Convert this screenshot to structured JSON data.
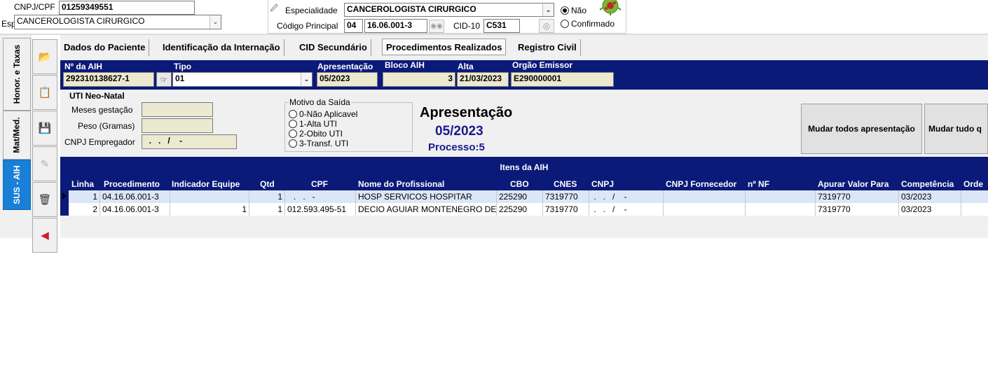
{
  "header": {
    "cnpj_label": "CNPJ/CPF",
    "cnpj_value": "01259349551",
    "esp_label_cut": "Esp",
    "esp_left_value": "CANCEROLOGISTA CIRURGICO",
    "especialidade_label": "Especialidade",
    "especialidade_value": "CANCEROLOGISTA CIRURGICO",
    "codigo_label": "Código Principal",
    "codigo_prefix": "04",
    "codigo_value": "16.06.001-3",
    "cid_label": "CID-10",
    "cid_value": "C531",
    "radio_nao": "Não",
    "radio_confirmado": "Confirmado"
  },
  "side_tabs": {
    "honor": "Honor. e Taxas",
    "mat": "Mat/Med.",
    "sus": "SUS - AIH"
  },
  "tabs": [
    "Dados do Paciente",
    "Identificação da Internação",
    "CID Secundário",
    "Procedimentos Realizados",
    "Registro Civil"
  ],
  "aih": {
    "num_label": "Nº da AIH",
    "num_value": "292310138627-1",
    "tipo_label": "Tipo",
    "tipo_value": "01",
    "apres_label": "Apresentação",
    "apres_value": "05/2023",
    "bloco_label": "Bloco AIH",
    "bloco_value": "3",
    "alta_label": "Alta",
    "alta_value": "21/03/2023",
    "orgao_label": "Orgão Emissor",
    "orgao_value": "E290000001"
  },
  "uti": {
    "title": "UTI Neo-Natal",
    "meses_label": "Meses gestação",
    "peso_label": "Peso (Gramas)",
    "cnpj_label": "CNPJ Empregador",
    "cnpj_mask": "  .   .   /    -"
  },
  "motivo": {
    "title": "Motivo da Saída",
    "options": [
      "0-Não Aplicavel",
      "1-Alta UTI",
      "2-Obito UTI",
      "3-Transf. UTI"
    ]
  },
  "apresentacao": {
    "title": "Apresentação",
    "date": "05/2023",
    "processo": "Processo:5"
  },
  "buttons": {
    "mudar_todos": "Mudar todos apresentação",
    "mudar_tudo": "Mudar tudo q"
  },
  "grid": {
    "title": "Itens da AIH",
    "columns": [
      "Linha",
      "Procedimento",
      "Indicador Equipe",
      "Qtd",
      "CPF",
      "Nome do Profissional",
      "CBO",
      "CNES",
      "CNPJ",
      "CNPJ Fornecedor",
      "nº NF",
      "Apurar Valor Para",
      "Competência",
      "Orde"
    ],
    "rows": [
      [
        "1",
        "04.16.06.001-3",
        "",
        "1",
        ".   .   -",
        "HOSP SERVICOS HOSPITAR",
        "225290",
        "7319770",
        " .   .   /    -",
        "",
        "",
        "7319770",
        "03/2023",
        ""
      ],
      [
        "2",
        "04.16.06.001-3",
        "1",
        "1",
        "012.593.495-51",
        "DECIO AGUIAR MONTENEGRO DE",
        "225290",
        "7319770",
        " .   .   /    -",
        "",
        "",
        "7319770",
        "03/2023",
        ""
      ]
    ]
  },
  "colors": {
    "navy": "#0b1a78",
    "tab_blue": "#1a7fd6",
    "field_tan": "#ece9d1",
    "row_selected": "#dbe7f7",
    "apres_blue": "#1a1a8c"
  },
  "icons": {
    "edit": "pencil-icon",
    "open": "folder-open-icon",
    "report": "report-icon",
    "save": "save-icon",
    "sign": "signature-icon",
    "delete": "trash-icon",
    "exit": "exit-arrow-icon",
    "hand": "pointing-hand-icon",
    "search": "binoculars-icon",
    "cid_search": "disc-icon",
    "virus": "virus-icon"
  }
}
